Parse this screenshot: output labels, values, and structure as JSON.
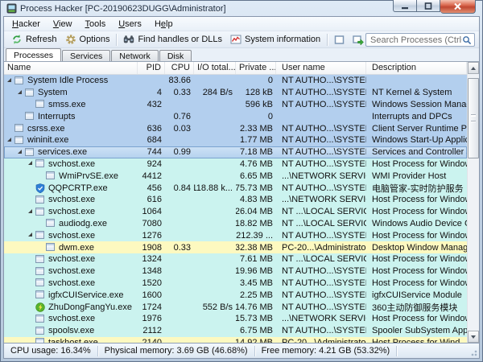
{
  "window": {
    "title": "Process Hacker [PC-20190623DUGG\\Administrator]"
  },
  "menu": [
    {
      "label": "Hacker",
      "underline": 0
    },
    {
      "label": "View",
      "underline": 0
    },
    {
      "label": "Tools",
      "underline": 0
    },
    {
      "label": "Users",
      "underline": 0
    },
    {
      "label": "Help",
      "underline": 1
    }
  ],
  "toolbar": {
    "buttons": [
      {
        "icon": "refresh-icon",
        "label": "Refresh"
      },
      {
        "icon": "options-icon",
        "label": "Options"
      },
      {
        "sep": true
      },
      {
        "icon": "find-handles-icon",
        "label": "Find handles or DLLs"
      },
      {
        "icon": "system-information-icon",
        "label": "System information"
      },
      {
        "sep": true
      },
      {
        "icon": "window-icon",
        "label": ""
      },
      {
        "icon": "window-arrow-icon",
        "label": ""
      },
      {
        "icon": "red-x-icon",
        "label": ""
      }
    ],
    "search_placeholder": "Search Processes (Ctrl+K)"
  },
  "tabs": [
    {
      "label": "Processes",
      "active": true
    },
    {
      "label": "Services",
      "active": false
    },
    {
      "label": "Network",
      "active": false
    },
    {
      "label": "Disk",
      "active": false
    }
  ],
  "columns": [
    "Name",
    "PID",
    "CPU",
    "I/O total...",
    "Private ...",
    "User name",
    "Description"
  ],
  "rows": [
    {
      "name": "System Idle Process",
      "level": 0,
      "expand": true,
      "icon": "app",
      "pid": "",
      "cpu": "83.66",
      "io": "",
      "private": "0",
      "user": "NT AUTHO...\\SYSTEM",
      "description": "",
      "bg": "blue",
      "selected": false
    },
    {
      "name": "System",
      "level": 1,
      "expand": true,
      "icon": "app",
      "pid": "4",
      "cpu": "0.33",
      "io": "284 B/s",
      "private": "128 kB",
      "user": "NT AUTHO...\\SYSTEM",
      "description": "NT Kernel & System",
      "bg": "blue",
      "selected": false
    },
    {
      "name": "smss.exe",
      "level": 2,
      "expand": false,
      "icon": "app",
      "pid": "432",
      "cpu": "",
      "io": "",
      "private": "596 kB",
      "user": "NT AUTHO...\\SYSTEM",
      "description": "Windows Session Manager",
      "bg": "blue",
      "selected": false
    },
    {
      "name": "Interrupts",
      "level": 1,
      "expand": false,
      "icon": "app",
      "pid": "",
      "cpu": "0.76",
      "io": "",
      "private": "0",
      "user": "",
      "description": "Interrupts and DPCs",
      "bg": "blue",
      "selected": false
    },
    {
      "name": "csrss.exe",
      "level": 0,
      "expand": false,
      "icon": "app",
      "pid": "636",
      "cpu": "0.03",
      "io": "",
      "private": "2.33 MB",
      "user": "NT AUTHO...\\SYSTEM",
      "description": "Client Server Runtime Proc...",
      "bg": "blue",
      "selected": false
    },
    {
      "name": "wininit.exe",
      "level": 0,
      "expand": true,
      "icon": "app",
      "pid": "684",
      "cpu": "",
      "io": "",
      "private": "1.77 MB",
      "user": "NT AUTHO...\\SYSTEM",
      "description": "Windows Start-Up Applicat...",
      "bg": "blue",
      "selected": false
    },
    {
      "name": "services.exe",
      "level": 1,
      "expand": true,
      "icon": "app",
      "pid": "744",
      "cpu": "0.99",
      "io": "",
      "private": "7.18 MB",
      "user": "NT AUTHO...\\SYSTEM",
      "description": "Services and Controller app",
      "bg": "blue",
      "selected": true
    },
    {
      "name": "svchost.exe",
      "level": 2,
      "expand": true,
      "icon": "app",
      "pid": "924",
      "cpu": "",
      "io": "",
      "private": "4.76 MB",
      "user": "NT AUTHO...\\SYSTEM",
      "description": "Host Process for Windows ...",
      "bg": "cyan",
      "selected": false
    },
    {
      "name": "WmiPrvSE.exe",
      "level": 3,
      "expand": false,
      "icon": "app",
      "pid": "4412",
      "cpu": "",
      "io": "",
      "private": "6.65 MB",
      "user": "...\\NETWORK SERVICE",
      "description": "WMI Provider Host",
      "bg": "cyan",
      "selected": false
    },
    {
      "name": "QQPCRTP.exe",
      "level": 2,
      "expand": false,
      "icon": "shield",
      "pid": "456",
      "cpu": "0.84",
      "io": "118.88 k...",
      "private": "75.73 MB",
      "user": "NT AUTHO...\\SYSTEM",
      "description": "电脑管家-实时防护服务",
      "bg": "cyan",
      "selected": false
    },
    {
      "name": "svchost.exe",
      "level": 2,
      "expand": false,
      "icon": "app",
      "pid": "616",
      "cpu": "",
      "io": "",
      "private": "4.83 MB",
      "user": "...\\NETWORK SERVICE",
      "description": "Host Process for Windows ...",
      "bg": "cyan",
      "selected": false
    },
    {
      "name": "svchost.exe",
      "level": 2,
      "expand": true,
      "icon": "app",
      "pid": "1064",
      "cpu": "",
      "io": "",
      "private": "26.04 MB",
      "user": "NT ...\\LOCAL SERVICE",
      "description": "Host Process for Windows ...",
      "bg": "cyan",
      "selected": false
    },
    {
      "name": "audiodg.exe",
      "level": 3,
      "expand": false,
      "icon": "app",
      "pid": "7080",
      "cpu": "",
      "io": "",
      "private": "18.82 MB",
      "user": "NT ...\\LOCAL SERVICE",
      "description": "Windows Audio Device Gra...",
      "bg": "cyan",
      "selected": false
    },
    {
      "name": "svchost.exe",
      "level": 2,
      "expand": true,
      "icon": "app",
      "pid": "1276",
      "cpu": "",
      "io": "",
      "private": "212.39 ...",
      "user": "NT AUTHO...\\SYSTEM",
      "description": "Host Process for Windows ...",
      "bg": "cyan",
      "selected": false
    },
    {
      "name": "dwm.exe",
      "level": 3,
      "expand": false,
      "icon": "app",
      "pid": "1908",
      "cpu": "0.33",
      "io": "",
      "private": "32.38 MB",
      "user": "PC-20...\\Administrator",
      "description": "Desktop Window Manager",
      "bg": "yellow",
      "selected": false
    },
    {
      "name": "svchost.exe",
      "level": 2,
      "expand": false,
      "icon": "app",
      "pid": "1324",
      "cpu": "",
      "io": "",
      "private": "7.61 MB",
      "user": "NT ...\\LOCAL SERVICE",
      "description": "Host Process for Windows ...",
      "bg": "cyan",
      "selected": false
    },
    {
      "name": "svchost.exe",
      "level": 2,
      "expand": false,
      "icon": "app",
      "pid": "1348",
      "cpu": "",
      "io": "",
      "private": "19.96 MB",
      "user": "NT AUTHO...\\SYSTEM",
      "description": "Host Process for Windows ...",
      "bg": "cyan",
      "selected": false
    },
    {
      "name": "svchost.exe",
      "level": 2,
      "expand": false,
      "icon": "app",
      "pid": "1520",
      "cpu": "",
      "io": "",
      "private": "3.45 MB",
      "user": "NT AUTHO...\\SYSTEM",
      "description": "Host Process for Windows ...",
      "bg": "cyan",
      "selected": false
    },
    {
      "name": "igfxCUIService.exe",
      "level": 2,
      "expand": false,
      "icon": "app",
      "pid": "1600",
      "cpu": "",
      "io": "",
      "private": "2.25 MB",
      "user": "NT AUTHO...\\SYSTEM",
      "description": "igfxCUIService Module",
      "bg": "cyan",
      "selected": false
    },
    {
      "name": "ZhuDongFangYu.exe",
      "level": 2,
      "expand": false,
      "icon": "green",
      "pid": "1724",
      "cpu": "",
      "io": "552 B/s",
      "private": "14.76 MB",
      "user": "NT AUTHO...\\SYSTEM",
      "description": "360主动防御服务模块",
      "bg": "cyan",
      "selected": false
    },
    {
      "name": "svchost.exe",
      "level": 2,
      "expand": false,
      "icon": "app",
      "pid": "1976",
      "cpu": "",
      "io": "",
      "private": "15.73 MB",
      "user": "...\\NETWORK SERVICE",
      "description": "Host Process for Windows ...",
      "bg": "cyan",
      "selected": false
    },
    {
      "name": "spoolsv.exe",
      "level": 2,
      "expand": false,
      "icon": "app",
      "pid": "2112",
      "cpu": "",
      "io": "",
      "private": "6.75 MB",
      "user": "NT AUTHO...\\SYSTEM",
      "description": "Spooler SubSystem App",
      "bg": "cyan",
      "selected": false
    },
    {
      "name": "taskhost.exe",
      "level": 2,
      "expand": false,
      "icon": "app",
      "pid": "2140",
      "cpu": "",
      "io": "",
      "private": "14.92 MB",
      "user": "PC-20...\\Administrator",
      "description": "Host Process for Wind...",
      "bg": "yellow",
      "selected": false
    }
  ],
  "status": [
    "CPU usage: 16.34%",
    "Physical memory: 3.69 GB (46.68%)",
    "Free memory: 4.21 GB (53.32%)"
  ],
  "colors": {
    "row_blue": "#b3cfee",
    "row_cyan": "#cbf3ef",
    "row_yellow": "#fdf9c0",
    "selection_border": "#7ba3cf",
    "close_button_red": "#c04832"
  }
}
